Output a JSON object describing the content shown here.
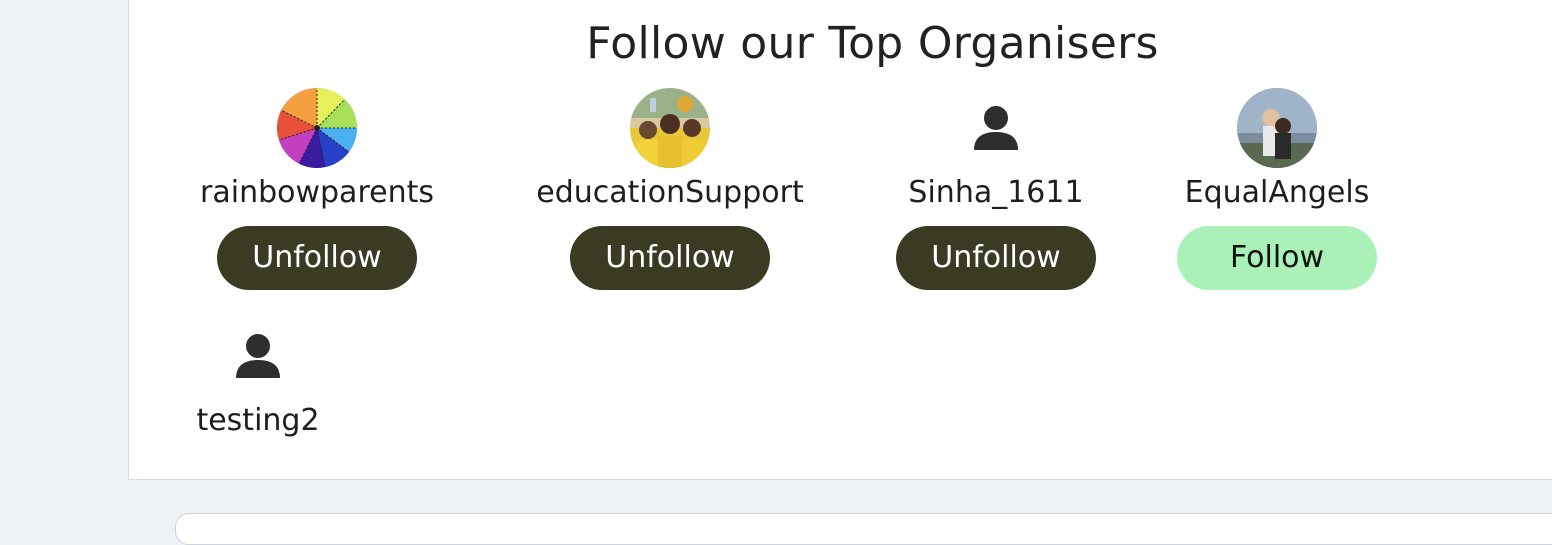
{
  "section": {
    "title": "Follow our Top Organisers"
  },
  "organisers": [
    {
      "name": "rainbowparents",
      "button": "Unfollow",
      "avatar": "rainbow-wheel-avatar"
    },
    {
      "name": "educationSupport",
      "button": "Unfollow",
      "avatar": "crowd-photo-avatar"
    },
    {
      "name": "Sinha_1611",
      "button": "Unfollow",
      "avatar": "user-icon"
    },
    {
      "name": "EqualAngels",
      "button": "Follow",
      "avatar": "couple-photo-avatar"
    },
    {
      "name": "testing2",
      "avatar": "user-icon"
    }
  ],
  "colors": {
    "unfollow_bg": "#3b3b23",
    "follow_bg": "#aaf1b8",
    "page_bg": "#eef2f6"
  }
}
